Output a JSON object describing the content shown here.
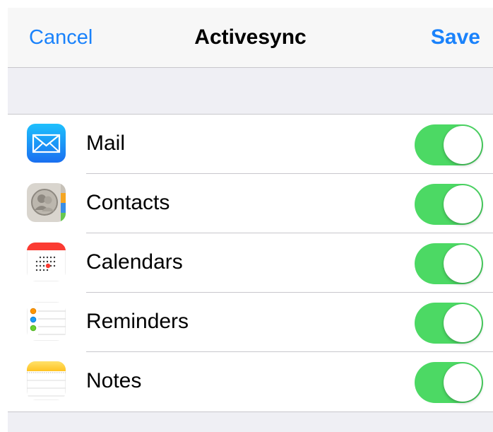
{
  "colors": {
    "accent": "#1a82fb",
    "toggle_on": "#4cd964",
    "background": "#efeff4"
  },
  "navbar": {
    "cancel_label": "Cancel",
    "title": "Activesync",
    "save_label": "Save"
  },
  "items": [
    {
      "label": "Mail",
      "icon": "mail-app-icon",
      "enabled": true
    },
    {
      "label": "Contacts",
      "icon": "contacts-app-icon",
      "enabled": true
    },
    {
      "label": "Calendars",
      "icon": "calendars-app-icon",
      "enabled": true
    },
    {
      "label": "Reminders",
      "icon": "reminders-app-icon",
      "enabled": true
    },
    {
      "label": "Notes",
      "icon": "notes-app-icon",
      "enabled": true
    }
  ]
}
